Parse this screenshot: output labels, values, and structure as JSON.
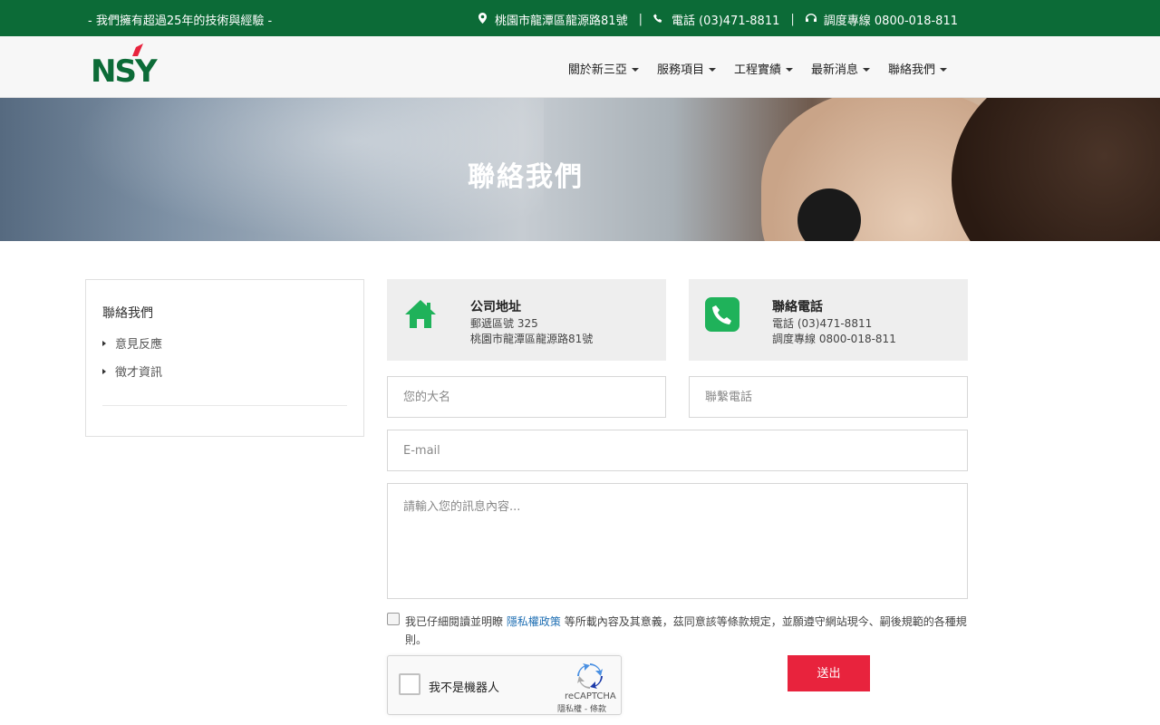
{
  "topbar": {
    "slogan": "- 我們擁有超過25年的技術與經驗 -",
    "address": "桃園市龍潭區龍源路81號",
    "phone": "電話 (03)471-8811",
    "hotline": "調度專線 0800-018-811",
    "separator": "|"
  },
  "logo": {
    "text": "NSY"
  },
  "nav": [
    {
      "label": "關於新三亞"
    },
    {
      "label": "服務項目"
    },
    {
      "label": "工程實績"
    },
    {
      "label": "最新消息"
    },
    {
      "label": "聯絡我們"
    }
  ],
  "banner": {
    "title": "聯絡我們"
  },
  "sidebar": {
    "title": "聯絡我們",
    "links": [
      {
        "label": "意見反應"
      },
      {
        "label": "徵才資訊"
      }
    ]
  },
  "cards": {
    "address": {
      "title": "公司地址",
      "line1": "郵遞區號 325",
      "line2": "桃園市龍潭區龍源路81號"
    },
    "phone": {
      "title": "聯絡電話",
      "line1": "電話 (03)471-8811",
      "line2": "調度專線 0800-018-811"
    }
  },
  "form": {
    "name_placeholder": "您的大名",
    "phone_placeholder": "聯繫電話",
    "email_placeholder": "E-mail",
    "message_placeholder": "請輸入您的訊息內容...",
    "agree_prefix": "我已仔細閱讀並明瞭",
    "agree_link": "隱私權政策",
    "agree_suffix": "等所載內容及其意義，茲同意該等條款規定，並願遵守網站現今、嗣後規範的各種規則。",
    "submit_label": "送出"
  },
  "recaptcha": {
    "label": "我不是機器人",
    "brand": "reCAPTCHA",
    "terms": "隱私權 - 條款"
  },
  "colors": {
    "brand_green": "#0c6b37",
    "icon_green": "#1fb25a",
    "submit_red": "#e8233d",
    "link_blue": "#1f6fb3"
  },
  "icons": {
    "address": "map-pin-icon",
    "phone": "phone-icon",
    "hotline": "headset-icon",
    "home": "home-icon",
    "card_phone": "phone-icon"
  }
}
